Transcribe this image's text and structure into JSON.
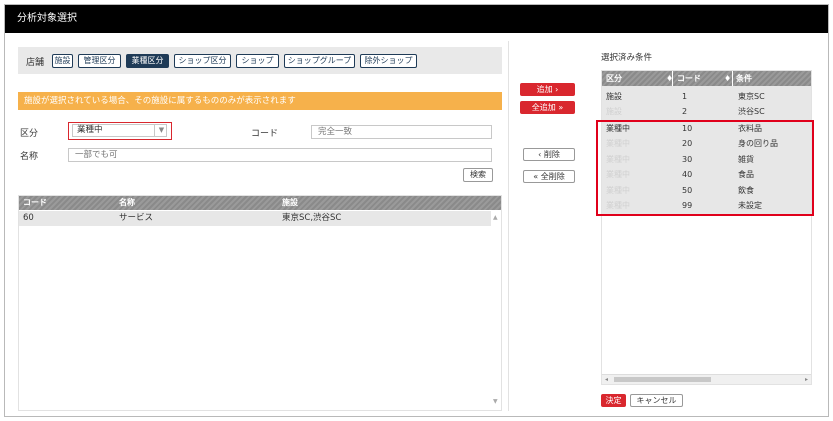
{
  "window": {
    "title": "分析対象選択"
  },
  "filterbar": {
    "label": "店舗",
    "tabs": [
      {
        "label": "施設",
        "active": false
      },
      {
        "label": "管理区分",
        "active": false
      },
      {
        "label": "業種区分",
        "active": true
      },
      {
        "label": "ショップ区分",
        "active": false
      },
      {
        "label": "ショップ",
        "active": false
      },
      {
        "label": "ショップグループ",
        "active": false
      },
      {
        "label": "除外ショップ",
        "active": false
      }
    ]
  },
  "notice": "施設が選択されている場合、その施設に属するもののみが表示されます",
  "form": {
    "kubun_label": "区分",
    "kubun_value": "業種中",
    "code_label": "コード",
    "code_placeholder": "完全一致",
    "name_label": "名称",
    "name_placeholder": "一部でも可",
    "search_label": "検索"
  },
  "left_grid": {
    "headers": {
      "code": "コード",
      "name": "名称",
      "facility": "施設"
    },
    "rows": [
      {
        "code": "60",
        "name": "サービス",
        "facility": "東京SC,渋谷SC"
      }
    ]
  },
  "middle_buttons": {
    "add": "追加 ›",
    "add_all": "全追加 »",
    "remove": "‹ 削除",
    "remove_all": "« 全削除"
  },
  "right_panel": {
    "title": "選択済み条件",
    "headers": {
      "kubun": "区分",
      "code": "コード",
      "condition": "条件"
    },
    "rows": [
      {
        "kubun": "施設",
        "ghost": false,
        "code": "1",
        "condition": "東京SC"
      },
      {
        "kubun": "施設",
        "ghost": true,
        "code": "2",
        "condition": "渋谷SC"
      },
      {
        "kubun": "業種中",
        "ghost": false,
        "code": "10",
        "condition": "衣料品"
      },
      {
        "kubun": "業種中",
        "ghost": true,
        "code": "20",
        "condition": "身の回り品"
      },
      {
        "kubun": "業種中",
        "ghost": true,
        "code": "30",
        "condition": "雑貨"
      },
      {
        "kubun": "業種中",
        "ghost": true,
        "code": "40",
        "condition": "食品"
      },
      {
        "kubun": "業種中",
        "ghost": true,
        "code": "50",
        "condition": "飲食"
      },
      {
        "kubun": "業種中",
        "ghost": true,
        "code": "99",
        "condition": "未設定"
      }
    ],
    "ok_label": "決定",
    "cancel_label": "キャンセル"
  },
  "colors": {
    "accent_red": "#d9272e",
    "navy": "#1f3b57",
    "notice_orange": "#f6b14b"
  }
}
